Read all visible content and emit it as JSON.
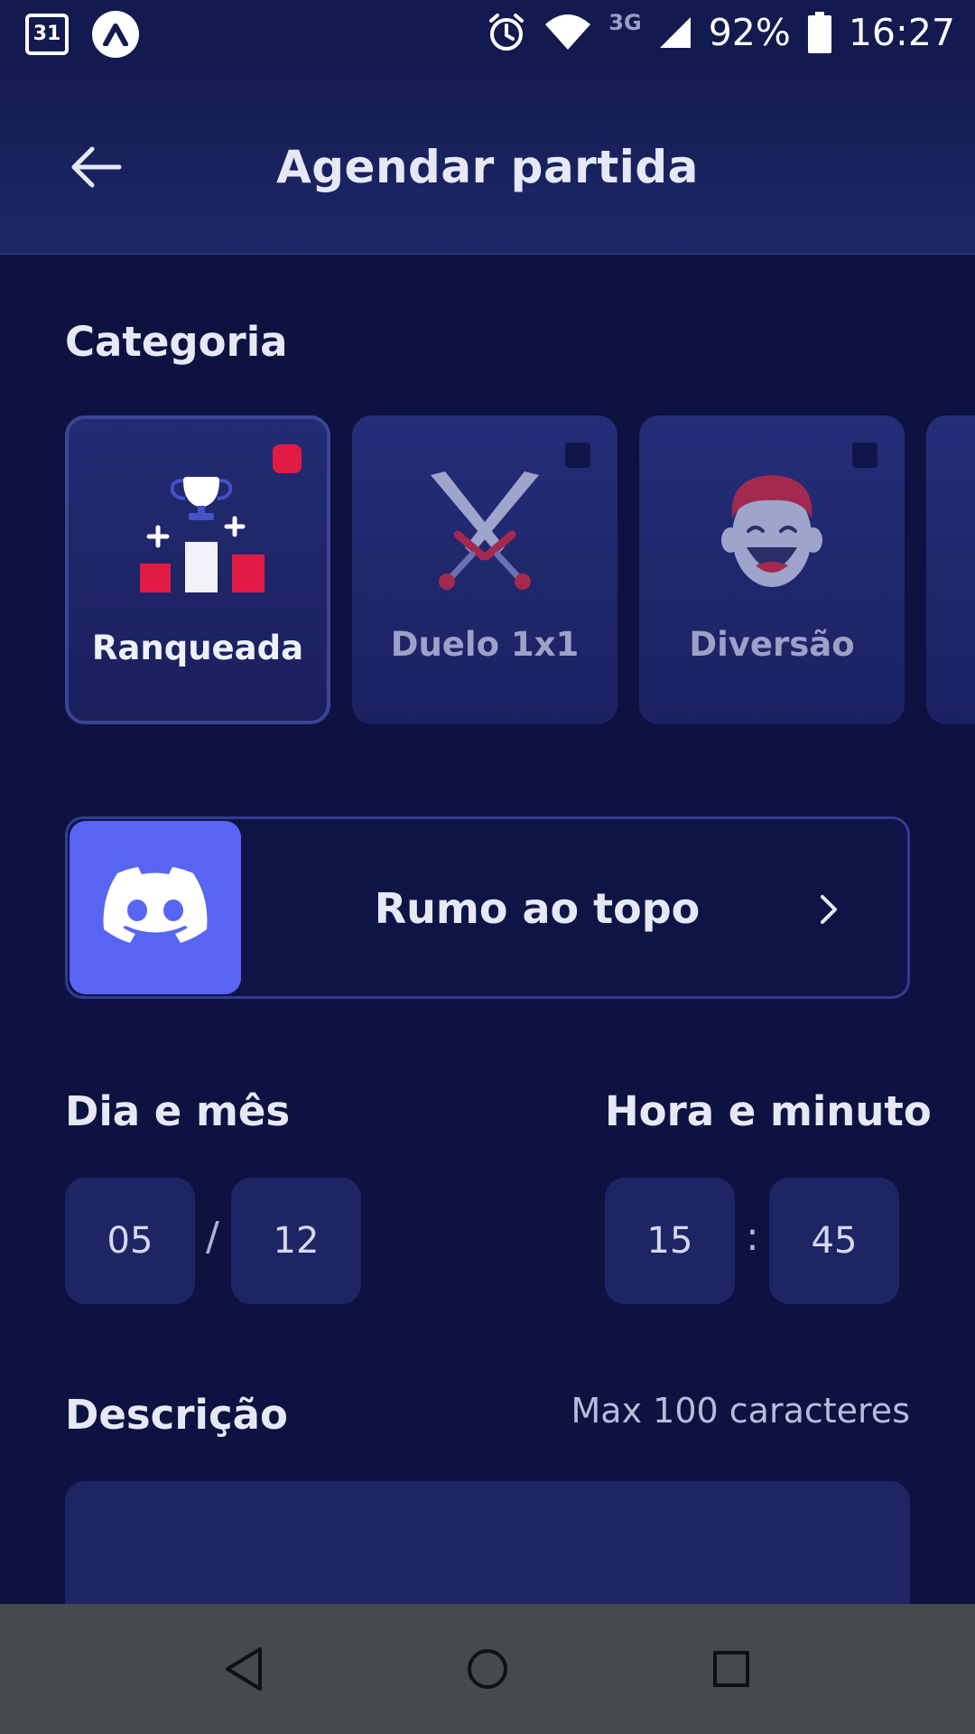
{
  "status_bar": {
    "calendar_day": "31",
    "network": "3G",
    "battery": "92%",
    "time": "16:27"
  },
  "header": {
    "title": "Agendar partida"
  },
  "category": {
    "title": "Categoria",
    "items": [
      {
        "label": "Ranqueada",
        "selected": true,
        "icon": "trophy-podium-icon"
      },
      {
        "label": "Duelo 1x1",
        "selected": false,
        "icon": "crossed-swords-icon"
      },
      {
        "label": "Diversão",
        "selected": false,
        "icon": "laughing-face-icon"
      }
    ]
  },
  "server": {
    "name": "Rumo ao topo",
    "icon": "discord-icon",
    "accent": "#5765F2"
  },
  "date": {
    "title": "Dia e mês",
    "day": "05",
    "month": "12",
    "separator": "/"
  },
  "time": {
    "title": "Hora e minuto",
    "hour": "15",
    "minute": "45",
    "separator": ":"
  },
  "description": {
    "title": "Descrição",
    "hint": "Max 100 caracteres",
    "value": ""
  },
  "colors": {
    "background": "#0E1240",
    "selected_check": "#E21B45",
    "card": "#242D78"
  }
}
